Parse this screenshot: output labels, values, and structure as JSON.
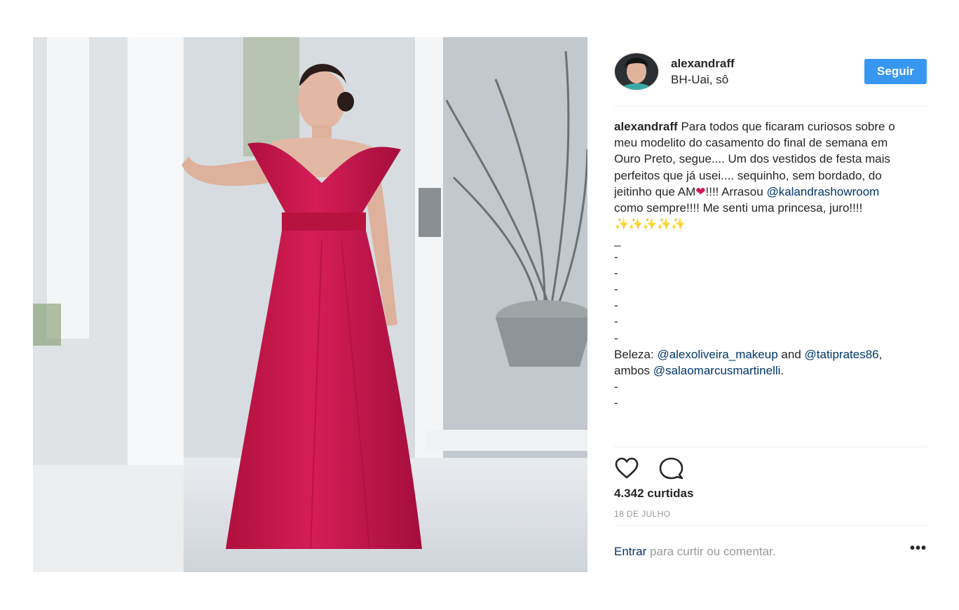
{
  "post": {
    "image_alt": "Woman in a red off-shoulder gown standing by a window",
    "user": {
      "username": "alexandraff",
      "location": "BH-Uai, sô",
      "follow_label": "Seguir"
    },
    "caption": {
      "author": "alexandraff",
      "text_1": "Para todos que ficaram curiosos sobre o meu modelito do casamento do final de semana em Ouro Preto, segue.... Um dos vestidos de festa mais perfeitos que já usei.... sequinho, sem bordado, do jeitinho que AM",
      "heart": "❤",
      "text_2": "!!!! Arrasou",
      "mention_1": "@kalandrashowroom",
      "text_3": "como sempre!!!! Me senti uma princesa, juro!!!!",
      "sparkles": "✨✨✨✨✨",
      "dashes": [
        "_",
        "-",
        "-",
        "-",
        "-",
        "-",
        "-"
      ],
      "beleza_label": "Beleza:",
      "mention_2": "@alexoliveira_makeup",
      "and_word": "and",
      "mention_3": "@tatiprates86",
      "ambos": ", ambos",
      "mention_4": "@salaomarcusmartinelli",
      "period": ".",
      "dashes_2": [
        "-",
        "-"
      ]
    },
    "likes": "4.342 curtidas",
    "date": "18 DE JULHO",
    "login": {
      "link": "Entrar",
      "text": "para curtir ou comentar."
    },
    "more_label": "•••",
    "icons": {
      "like": "heart-icon",
      "comment": "comment-icon",
      "more": "more-options-icon"
    },
    "colors": {
      "follow_button": "#3897f0",
      "link": "#003569",
      "dress": "#c8164e"
    }
  }
}
